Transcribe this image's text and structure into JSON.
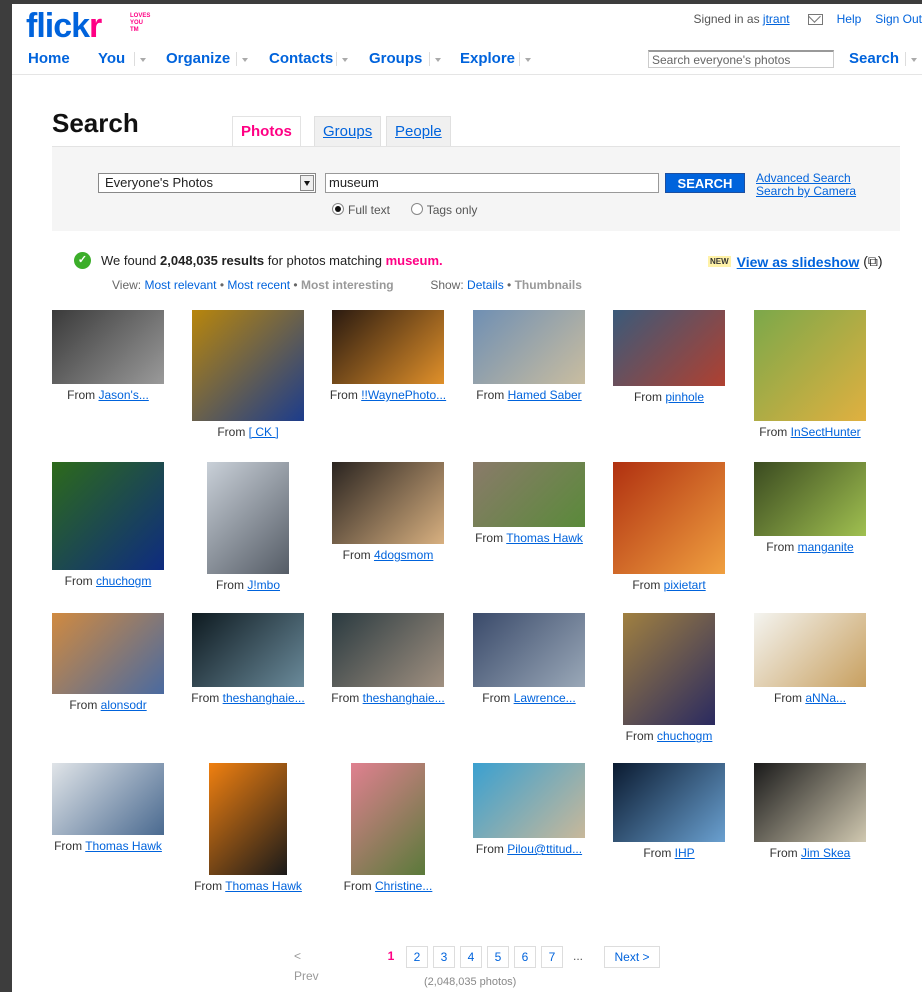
{
  "header": {
    "logo_main": "flick",
    "logo_r": "r",
    "logo_tag": "LOVES YOU",
    "logo_tm": "TM",
    "signed_in_prefix": "Signed in as",
    "user": "jtrant",
    "help": "Help",
    "sign_out": "Sign Out"
  },
  "nav": {
    "items": [
      "Home",
      "You",
      "Organize",
      "Contacts",
      "Groups",
      "Explore"
    ],
    "search_placeholder": "Search everyone's photos",
    "search_button": "Search"
  },
  "search": {
    "title": "Search",
    "tabs": [
      "Photos",
      "Groups",
      "People"
    ],
    "scope": "Everyone's Photos",
    "query": "museum",
    "button": "SEARCH",
    "advanced": "Advanced Search",
    "by_camera": "Search by Camera",
    "full_text": "Full text",
    "tags_only": "Tags only"
  },
  "results": {
    "found_prefix": "We found",
    "count": "2,048,035 results",
    "found_mid": "for photos matching",
    "keyword": "museum.",
    "view_label": "View:",
    "most_relevant": "Most relevant",
    "most_recent": "Most recent",
    "most_interesting": "Most interesting",
    "show_label": "Show:",
    "details": "Details",
    "thumbnails": "Thumbnails",
    "new_badge": "NEW",
    "slideshow": "View as slideshow",
    "slideshow_suffix": "(⧉)"
  },
  "photos": [
    {
      "from": "From",
      "author": "Jason's...",
      "colors": [
        "#3a3a3a",
        "#9a9a9a"
      ]
    },
    {
      "from": "From",
      "author": "[ CK ]",
      "colors": [
        "#b8860b",
        "#1c3c8c"
      ]
    },
    {
      "from": "From",
      "author": "!!WaynePhoto...",
      "colors": [
        "#2a1a10",
        "#e0902a"
      ]
    },
    {
      "from": "From",
      "author": "Hamed Saber",
      "colors": [
        "#6f8fb3",
        "#c9bda0"
      ]
    },
    {
      "from": "From",
      "author": "pinhole",
      "colors": [
        "#3a5a7a",
        "#b04030"
      ]
    },
    {
      "from": "From",
      "author": "InSectHunter",
      "colors": [
        "#7ba84a",
        "#e0b040"
      ]
    },
    {
      "from": "From",
      "author": "chuchogm",
      "colors": [
        "#2d6a1a",
        "#0e2b80"
      ]
    },
    {
      "from": "From",
      "author": "J!mbo",
      "colors": [
        "#c9d0d8",
        "#555c66"
      ]
    },
    {
      "from": "From",
      "author": "4dogsmom",
      "colors": [
        "#2a2420",
        "#d8b080"
      ]
    },
    {
      "from": "From",
      "author": "Thomas Hawk",
      "colors": [
        "#8a7a6a",
        "#5a8a3a"
      ]
    },
    {
      "from": "From",
      "author": "pixietart",
      "colors": [
        "#b03010",
        "#f0a040"
      ]
    },
    {
      "from": "From",
      "author": "manganite",
      "colors": [
        "#3a4a20",
        "#a0c050"
      ]
    },
    {
      "from": "From",
      "author": "alonsodr",
      "colors": [
        "#d08a40",
        "#4a6aa0"
      ]
    },
    {
      "from": "From",
      "author": "theshanghaie...",
      "colors": [
        "#0e1a20",
        "#6a8a9a"
      ]
    },
    {
      "from": "From",
      "author": "theshanghaie...",
      "colors": [
        "#2a3a40",
        "#a09080"
      ]
    },
    {
      "from": "From",
      "author": "Lawrence...",
      "colors": [
        "#3a4a6a",
        "#9aa8b8"
      ]
    },
    {
      "from": "From",
      "author": "chuchogm",
      "colors": [
        "#a08040",
        "#2a2a60"
      ]
    },
    {
      "from": "From",
      "author": "aNNa...",
      "colors": [
        "#f4f4f0",
        "#c8a060"
      ]
    },
    {
      "from": "From",
      "author": "Thomas Hawk",
      "colors": [
        "#e0e4e8",
        "#4a6a90"
      ]
    },
    {
      "from": "From",
      "author": "Thomas Hawk",
      "colors": [
        "#f08010",
        "#1a1a1a"
      ]
    },
    {
      "from": "From",
      "author": "Christine...",
      "colors": [
        "#e08090",
        "#5a7a3a"
      ]
    },
    {
      "from": "From",
      "author": "Pilou@ttitud...",
      "colors": [
        "#3aa0d0",
        "#c8b89a"
      ]
    },
    {
      "from": "From",
      "author": "IHP",
      "colors": [
        "#0a1a30",
        "#6aa0d0"
      ]
    },
    {
      "from": "From",
      "author": "Jim Skea",
      "colors": [
        "#1a1a1a",
        "#d0c8b0"
      ]
    }
  ],
  "pager": {
    "prev": "< Prev",
    "pages": [
      "1",
      "2",
      "3",
      "4",
      "5",
      "6",
      "7"
    ],
    "ellipsis": "...",
    "next": "Next >",
    "total": "(2,048,035 photos)"
  }
}
